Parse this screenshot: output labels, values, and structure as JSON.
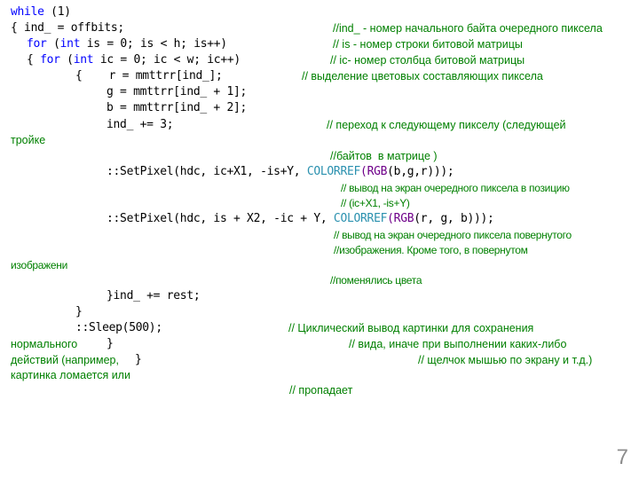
{
  "code_lines": {
    "l1_kw": "while",
    "l1_rest": " (1)",
    "l2": "{ ind_ = offbits;",
    "l3_kw1": "for",
    "l3_a": " (",
    "l3_kw2": "int",
    "l3_b": " is = 0; is < h; is++)",
    "l4_a": "{ ",
    "l4_kw1": "for",
    "l4_b": " (",
    "l4_kw2": "int",
    "l4_c": " ic = 0; ic < w; ic++)",
    "l5": "{    r = mmttrr[ind_];",
    "l6": "g = mmttrr[ind_ + 1];",
    "l7": "b = mmttrr[ind_ + 2];",
    "l8": "ind_ += 3;",
    "l9_a": "::SetPixel(hdc, ic+X1, -is+Y, ",
    "l9_type": "COLORREF",
    "l9_b": "(",
    "l9_macro": "RGB",
    "l9_c": "(b,g,r)));",
    "l10_a": "::SetPixel(hdc, is + X2, -ic + Y, ",
    "l10_type": "COLORREF",
    "l10_b": "(",
    "l10_macro": "RGB",
    "l10_c": "(r, g, b)));",
    "l11": "}ind_ += rest;",
    "l12": "}",
    "l13": "::Sleep(500);",
    "l14": "}",
    "l15": "}"
  },
  "comments": {
    "c1": "//ind_ - номер начального байта очередного пиксела",
    "c2": "// is - номер строки битовой матрицы",
    "c3": "// ic- номер столбца битовой матрицы",
    "c4": "// выделение цветовых составляющих пиксела",
    "c5": "// переход к следующему пикселу (следующей",
    "c5_wrap": "тройке",
    "c6": "//байтов  в матрице )",
    "c7": "// вывод на экран очередного пиксела в позицию",
    "c8": "// (ic+X1, -is+Y)",
    "c9": "// вывод на экран очередного пиксела повернутого",
    "c10": "//изображения. Кроме того, в повернутом",
    "c10_wrap": "изображени",
    "c11": "//поменялись цвета",
    "c12": "// Циклический вывод картинки для сохранения",
    "c12_wrap": "нормального",
    "c13": "// вида, иначе при выполнении каких-либо",
    "c13_wrap": "действий (например,",
    "c14": "// щелчок мышью по экрану и т.д.)",
    "c14_wrap": "картинка ломается или",
    "c15": "// пропадает"
  },
  "page_number": "7",
  "colors": {
    "code": "#000000",
    "keyword": "#0000ff",
    "type": "#2b91af",
    "macro": "#6f008a",
    "comment": "#008000",
    "page_number": "#8c8c8c"
  }
}
